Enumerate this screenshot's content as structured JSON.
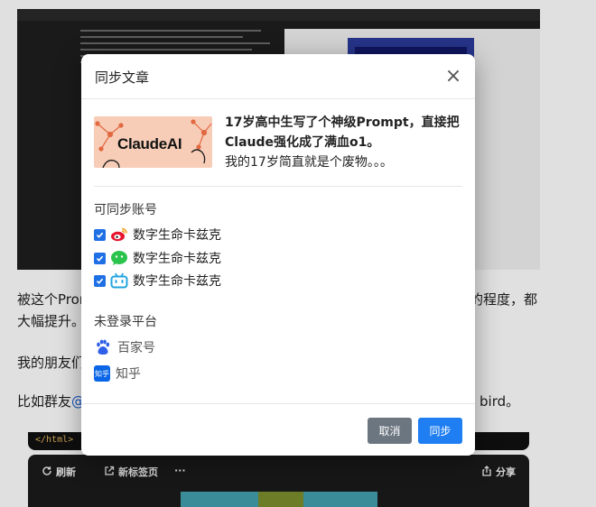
{
  "background": {
    "para1_start": "被这个Prom",
    "para1_end": "的程度，都",
    "para1_line2": "大幅提升。",
    "para2": "我的朋友们",
    "para3_prefix": "比如群友",
    "para3_mention": "@",
    "para3_end": "bird。",
    "code_tag": "</html>",
    "toolbar": {
      "refresh": "刷新",
      "new_tab": "新标签页",
      "more": "···",
      "share": "分享"
    }
  },
  "modal": {
    "title": "同步文章",
    "close": "×",
    "article": {
      "thumb_brand": "ClaudeAI",
      "title": "17岁高中生写了个神级Prompt，直接把Claude强化成了满血o1。",
      "subtitle": "我的17岁简直就是个废物。。。"
    },
    "syncable_label": "可同步账号",
    "accounts": [
      {
        "platform": "weibo",
        "icon": "weibo-icon",
        "name": "数字生命卡兹克",
        "checked": true
      },
      {
        "platform": "wechat",
        "icon": "wechat-icon",
        "name": "数字生命卡兹克",
        "checked": true
      },
      {
        "platform": "bilibili",
        "icon": "bilibili-icon",
        "name": "数字生命卡兹克",
        "checked": true
      }
    ],
    "unlogged_label": "未登录平台",
    "platforms": [
      {
        "icon": "baijiahao-icon",
        "name": "百家号"
      },
      {
        "icon": "zhihu-icon",
        "name": "知乎",
        "icon_text": "知乎"
      }
    ],
    "buttons": {
      "cancel": "取消",
      "sync": "同步"
    }
  },
  "colors": {
    "primary": "#1e7ef2",
    "secondary": "#6c7680",
    "checkbox": "#1f6fe5",
    "weibo": "#e6162d",
    "wechat": "#2ac34b",
    "bilibili": "#20a5e0",
    "baijiahao": "#2f5fe8",
    "zhihu": "#0a66e6"
  }
}
